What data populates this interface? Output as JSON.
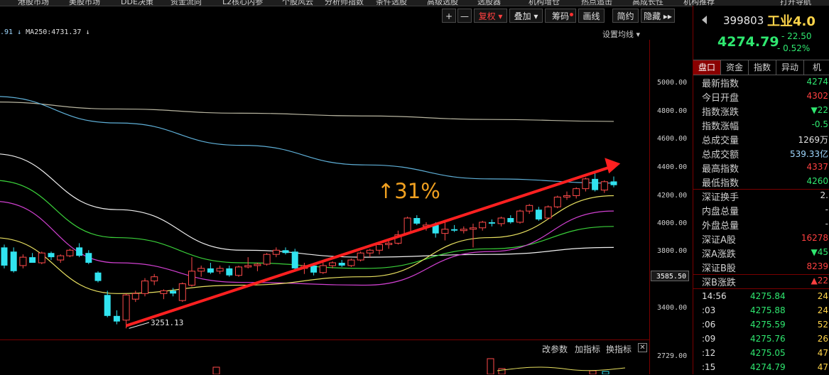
{
  "topnav": [
    "港股市场",
    "美股市场",
    "DDE决策",
    "资金流向",
    "L2核心内参",
    "个股风云",
    "分析师指数",
    "条件选股",
    "高级选股",
    "选股器",
    "机构增仓",
    "热点追击",
    "高成长性",
    "机构推荐",
    "打开导航"
  ],
  "toolbar": {
    "plus": "+",
    "minus": "—",
    "fuquan": "复权 ▾",
    "diejia": "叠加 ▾",
    "chouma": "筹码",
    "huaxian": "画线",
    "jianjie": "简约",
    "yincang": "隐藏 ▸▸"
  },
  "ma": {
    "prefix": ".91",
    "label": "MA250:4731.37"
  },
  "set_ma": "设置均线 ▾",
  "y_labels": [
    "5000.00",
    "4800.00",
    "4600.00",
    "4400.00",
    "4200.00",
    "4000.00",
    "3800.00",
    "3400.00",
    "2729.00"
  ],
  "current_price_label": "3585.50",
  "low_label": "3251.13",
  "annotation": "↑31%",
  "subbar": {
    "params": "改参数",
    "add": "加指标",
    "switch": "换指标",
    "close": "✕"
  },
  "quote": {
    "code": "399803",
    "name": "工业4.0",
    "price": "4274.79",
    "change": "- 22.50",
    "change_pct": "- 0.52%"
  },
  "tabs": [
    "盘口",
    "资金",
    "指数",
    "异动",
    "机"
  ],
  "stats": [
    {
      "k": "最新指数",
      "v": "4274",
      "c": "#2fe870"
    },
    {
      "k": "今日开盘",
      "v": "4302",
      "c": "#ff4040"
    },
    {
      "k": "指数涨跌",
      "v": "▼22",
      "c": "#2fe870"
    },
    {
      "k": "指数涨幅",
      "v": "-0.5",
      "c": "#2fe870"
    },
    {
      "k": "总成交量",
      "v": "1269万",
      "c": "#e0e0e0"
    },
    {
      "k": "总成交额",
      "v": "539.33亿",
      "c": "#9fd8ff"
    },
    {
      "k": "最高指数",
      "v": "4337",
      "c": "#ff4040"
    },
    {
      "k": "最低指数",
      "v": "4260",
      "c": "#2fe870"
    },
    {
      "k": "深证换手",
      "v": "2.",
      "c": "#e0e0e0"
    },
    {
      "k": "内盘总量",
      "v": "-",
      "c": "#e0e0e0"
    },
    {
      "k": "外盘总量",
      "v": "-",
      "c": "#e0e0e0"
    },
    {
      "k": "深证A股",
      "v": "16278",
      "c": "#ff4040"
    },
    {
      "k": "深A涨跌",
      "v": "▼45",
      "c": "#2fe870"
    },
    {
      "k": "深证B股",
      "v": "8239",
      "c": "#ff4040"
    },
    {
      "k": "深B涨跌",
      "v": "▲22",
      "c": "#ff4040"
    }
  ],
  "ticks": [
    {
      "t": "14:56",
      "p": "4275.84",
      "q": "24"
    },
    {
      "t": ":03",
      "p": "4275.88",
      "q": "24"
    },
    {
      "t": ":06",
      "p": "4275.59",
      "q": "52"
    },
    {
      "t": ":09",
      "p": "4275.76",
      "q": "26"
    },
    {
      "t": ":12",
      "p": "4275.05",
      "q": "47"
    },
    {
      "t": ":15",
      "p": "4274.79",
      "q": "47"
    }
  ],
  "chart_data": {
    "type": "candlestick",
    "y_range": [
      3200,
      5150
    ],
    "candles": [
      {
        "o": 3830,
        "h": 3850,
        "l": 3680,
        "c": 3700
      },
      {
        "o": 3800,
        "h": 3830,
        "l": 3650,
        "c": 3660
      },
      {
        "o": 3700,
        "h": 3780,
        "l": 3680,
        "c": 3760
      },
      {
        "o": 3760,
        "h": 3790,
        "l": 3720,
        "c": 3720
      },
      {
        "o": 3720,
        "h": 3800,
        "l": 3710,
        "c": 3790
      },
      {
        "o": 3790,
        "h": 3800,
        "l": 3740,
        "c": 3760
      },
      {
        "o": 3740,
        "h": 3780,
        "l": 3720,
        "c": 3770
      },
      {
        "o": 3770,
        "h": 3820,
        "l": 3760,
        "c": 3810
      },
      {
        "o": 3830,
        "h": 3860,
        "l": 3760,
        "c": 3770
      },
      {
        "o": 3790,
        "h": 3810,
        "l": 3710,
        "c": 3720
      },
      {
        "o": 3650,
        "h": 3660,
        "l": 3580,
        "c": 3590
      },
      {
        "o": 3490,
        "h": 3520,
        "l": 3330,
        "c": 3340
      },
      {
        "o": 3340,
        "h": 3380,
        "l": 3280,
        "c": 3300
      },
      {
        "o": 3310,
        "h": 3500,
        "l": 3251,
        "c": 3490
      },
      {
        "o": 3460,
        "h": 3520,
        "l": 3440,
        "c": 3500
      },
      {
        "o": 3500,
        "h": 3610,
        "l": 3480,
        "c": 3590
      },
      {
        "o": 3590,
        "h": 3640,
        "l": 3560,
        "c": 3620
      },
      {
        "o": 3500,
        "h": 3530,
        "l": 3460,
        "c": 3520
      },
      {
        "o": 3520,
        "h": 3540,
        "l": 3480,
        "c": 3500
      },
      {
        "o": 3450,
        "h": 3580,
        "l": 3440,
        "c": 3570
      },
      {
        "o": 3560,
        "h": 3760,
        "l": 3550,
        "c": 3660
      },
      {
        "o": 3660,
        "h": 3700,
        "l": 3620,
        "c": 3680
      },
      {
        "o": 3680,
        "h": 3720,
        "l": 3640,
        "c": 3650
      },
      {
        "o": 3660,
        "h": 3700,
        "l": 3640,
        "c": 3680
      },
      {
        "o": 3680,
        "h": 3700,
        "l": 3620,
        "c": 3630
      },
      {
        "o": 3630,
        "h": 3700,
        "l": 3620,
        "c": 3690
      },
      {
        "o": 3690,
        "h": 3760,
        "l": 3680,
        "c": 3700
      },
      {
        "o": 3700,
        "h": 3720,
        "l": 3660,
        "c": 3710
      },
      {
        "o": 3710,
        "h": 3790,
        "l": 3700,
        "c": 3780
      },
      {
        "o": 3780,
        "h": 3830,
        "l": 3760,
        "c": 3810
      },
      {
        "o": 3810,
        "h": 3830,
        "l": 3780,
        "c": 3790
      },
      {
        "o": 3800,
        "h": 3820,
        "l": 3660,
        "c": 3680
      },
      {
        "o": 3680,
        "h": 3720,
        "l": 3640,
        "c": 3700
      },
      {
        "o": 3700,
        "h": 3720,
        "l": 3630,
        "c": 3650
      },
      {
        "o": 3650,
        "h": 3720,
        "l": 3640,
        "c": 3700
      },
      {
        "o": 3700,
        "h": 3730,
        "l": 3680,
        "c": 3720
      },
      {
        "o": 3720,
        "h": 3740,
        "l": 3690,
        "c": 3700
      },
      {
        "o": 3700,
        "h": 3750,
        "l": 3690,
        "c": 3740
      },
      {
        "o": 3740,
        "h": 3800,
        "l": 3730,
        "c": 3790
      },
      {
        "o": 3790,
        "h": 3820,
        "l": 3760,
        "c": 3810
      },
      {
        "o": 3810,
        "h": 3860,
        "l": 3780,
        "c": 3850
      },
      {
        "o": 3850,
        "h": 3880,
        "l": 3820,
        "c": 3860
      },
      {
        "o": 3860,
        "h": 3950,
        "l": 3850,
        "c": 3920
      },
      {
        "o": 3930,
        "h": 4050,
        "l": 3920,
        "c": 4040
      },
      {
        "o": 4040,
        "h": 4060,
        "l": 3990,
        "c": 4000
      },
      {
        "o": 3980,
        "h": 4010,
        "l": 3950,
        "c": 3990
      },
      {
        "o": 3990,
        "h": 4010,
        "l": 3900,
        "c": 3930
      },
      {
        "o": 3930,
        "h": 4010,
        "l": 3880,
        "c": 3960
      },
      {
        "o": 3960,
        "h": 3990,
        "l": 3940,
        "c": 3950
      },
      {
        "o": 3950,
        "h": 3980,
        "l": 3930,
        "c": 3960
      },
      {
        "o": 3960,
        "h": 4000,
        "l": 3830,
        "c": 3970
      },
      {
        "o": 3970,
        "h": 4020,
        "l": 3950,
        "c": 4010
      },
      {
        "o": 4010,
        "h": 4030,
        "l": 3980,
        "c": 4000
      },
      {
        "o": 4000,
        "h": 4050,
        "l": 3980,
        "c": 4040
      },
      {
        "o": 4040,
        "h": 4060,
        "l": 4000,
        "c": 4010
      },
      {
        "o": 4010,
        "h": 4100,
        "l": 4000,
        "c": 4090
      },
      {
        "o": 4090,
        "h": 4140,
        "l": 4070,
        "c": 4130
      },
      {
        "o": 4100,
        "h": 4120,
        "l": 4020,
        "c": 4030
      },
      {
        "o": 4040,
        "h": 4130,
        "l": 4030,
        "c": 4120
      },
      {
        "o": 4120,
        "h": 4200,
        "l": 4110,
        "c": 4190
      },
      {
        "o": 4190,
        "h": 4230,
        "l": 4170,
        "c": 4200
      },
      {
        "o": 4200,
        "h": 4260,
        "l": 4180,
        "c": 4250
      },
      {
        "o": 4250,
        "h": 4330,
        "l": 4230,
        "c": 4320
      },
      {
        "o": 4320,
        "h": 4360,
        "l": 4230,
        "c": 4240
      },
      {
        "o": 4240,
        "h": 4310,
        "l": 4220,
        "c": 4300
      },
      {
        "o": 4302,
        "h": 4337,
        "l": 4260,
        "c": 4275
      }
    ],
    "ma_lines": [
      {
        "color": "#b8b5a0",
        "points": [
          4870,
          4820,
          4790,
          4770,
          4745,
          4731
        ]
      },
      {
        "color": "#5fb0d8",
        "points": [
          4910,
          4720,
          4560,
          4420,
          4320,
          4290
        ]
      },
      {
        "color": "#f0f0f0",
        "points": [
          4500,
          4100,
          3810,
          3760,
          3780,
          3830
        ]
      },
      {
        "color": "#3ad03a",
        "points": [
          4310,
          3900,
          3720,
          3680,
          3820,
          3980
        ]
      },
      {
        "color": "#d040d0",
        "points": [
          4160,
          3720,
          3580,
          3560,
          3800,
          4090
        ]
      },
      {
        "color": "#e8e060",
        "points": [
          3900,
          3500,
          3560,
          3620,
          3900,
          4200
        ]
      }
    ],
    "trend": {
      "from": [
        13,
        3270
      ],
      "to": [
        66,
        4420
      ]
    }
  }
}
